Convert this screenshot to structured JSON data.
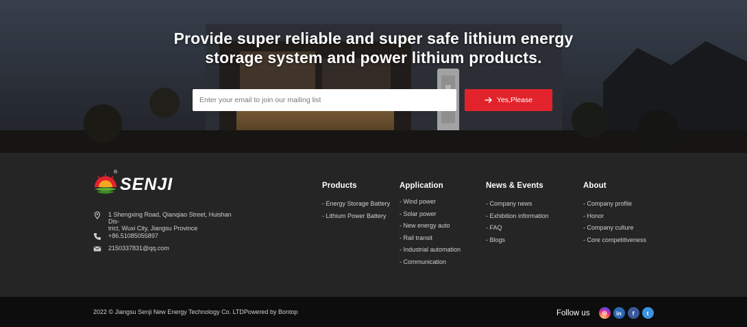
{
  "hero": {
    "title_line1": "Provide super reliable and super safe lithium energy",
    "title_line2": "storage system and power lithium products.",
    "email_placeholder": "Enter your email to join our mailing list",
    "cta_label": "Yes,Please"
  },
  "brand": {
    "logo_text": "SENJI",
    "logo_mark": "®"
  },
  "contact": {
    "address": "1 Shengxing Road, Qianqiao Street, Huishan District, Wuxi City, Jiangsu Province",
    "address_line1": "1 Shengxing Road, Qianqiao Street, Huishan Dis-",
    "address_line2": "trict, Wuxi City, Jiangsu Province",
    "phone": "+86.51085055897",
    "email": "2150337831@qq.com"
  },
  "columns": {
    "products": {
      "title": "Products",
      "items": [
        "- Energy Storage Battery",
        "- Lithium Power Battery"
      ]
    },
    "application": {
      "title": "Application",
      "items": [
        "- Wind power",
        "- Solar power",
        "- New energy auto",
        "- Rail transit",
        "- Industrial automation",
        "- Communication"
      ]
    },
    "news": {
      "title": "News & Events",
      "items": [
        "- Company news",
        "- Exhibition information",
        "- FAQ",
        "- Blogs"
      ]
    },
    "about": {
      "title": "About",
      "items": [
        "- Company profile",
        "- Honor",
        "- Company culture",
        "- Core competitiveness"
      ]
    }
  },
  "bottom": {
    "copyright": "2022 © Jiangsu Senji New Energy Technology Co. LTDPowered by Bontop",
    "follow_label": "Follow us",
    "social": [
      {
        "name": "instagram-icon",
        "glyph": "◎"
      },
      {
        "name": "linkedin-icon",
        "glyph": "in"
      },
      {
        "name": "facebook-icon",
        "glyph": "f"
      },
      {
        "name": "twitter-icon",
        "glyph": "t"
      }
    ]
  },
  "colors": {
    "accent": "#e3232b",
    "footer_bg": "#252525",
    "bottom_bg": "#0d0d0d"
  }
}
